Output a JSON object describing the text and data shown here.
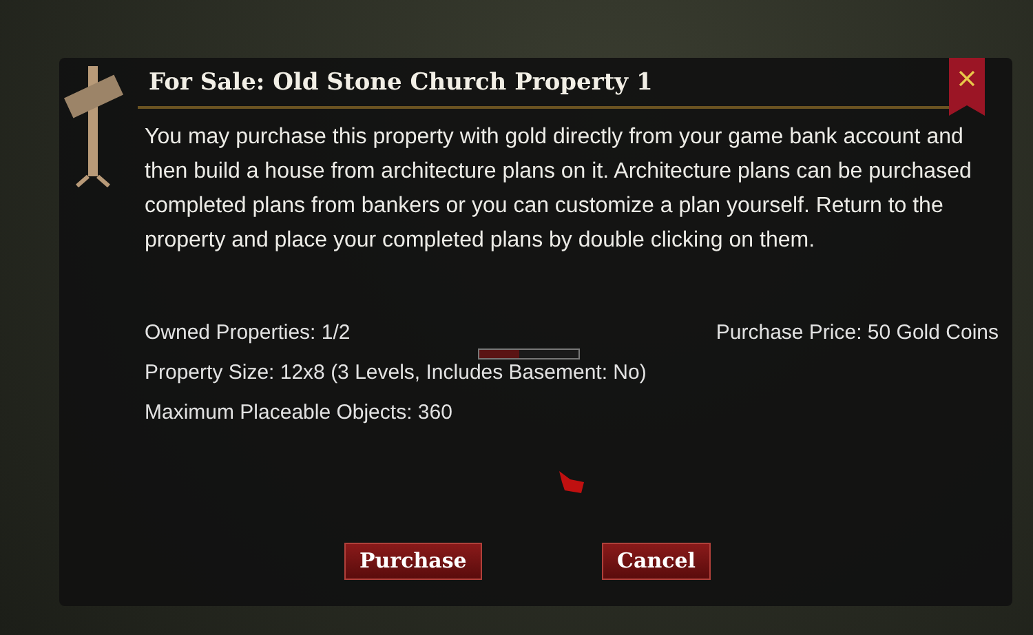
{
  "dialog": {
    "title": "For Sale: Old Stone Church Property 1",
    "description": "You may purchase this property with gold directly from your game bank account and then build a house from architecture plans on it. Architecture plans can be purchased completed plans from bankers or you can customize a plan yourself. Return to the property and place your completed plans by double clicking on them.",
    "owned_properties": "Owned Properties: 1/2",
    "purchase_price": "Purchase Price: 50 Gold Coins",
    "property_size": "Property Size: 12x8 (3 Levels, Includes Basement: No)",
    "max_objects": "Maximum Placeable Objects: 360",
    "buttons": [
      "Purchase",
      "Cancel"
    ]
  },
  "scene": {
    "health_bar": {
      "level": 0.4
    }
  }
}
